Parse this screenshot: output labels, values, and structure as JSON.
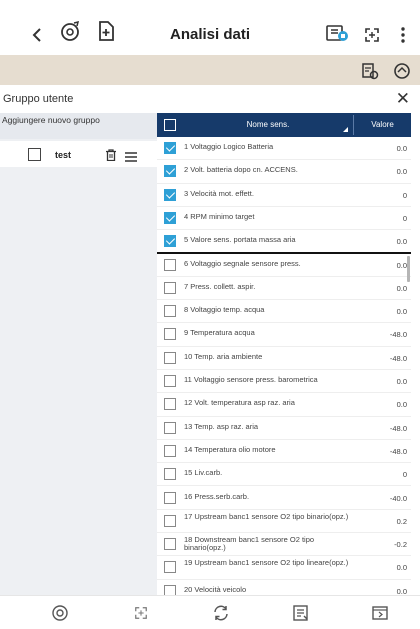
{
  "header": {
    "title": "Analisi dati",
    "icons": [
      "back-icon",
      "gauge-settings-icon",
      "add-document-icon",
      "dataset-icon",
      "fullscreen-icon",
      "more-vert-icon"
    ]
  },
  "toolbar": {
    "icons": [
      "recording-file-icon",
      "gauge-icon"
    ],
    "bg_color": "#e6ddd0"
  },
  "group_panel": {
    "title": "Gruppo utente",
    "add_label": "Aggiungere nuovo gruppo",
    "groups": [
      {
        "name": "test"
      }
    ]
  },
  "table": {
    "header_color": "#163a6a",
    "checked_color": "#2ea0d6",
    "columns": {
      "name": "Nome sens.",
      "value": "Valore"
    },
    "rows": [
      {
        "label": "1 Voltaggio Logico Batteria",
        "value": "0.0",
        "checked": true
      },
      {
        "label": "2 Volt. batteria dopo cn. ACCENS.",
        "value": "0.0",
        "checked": true
      },
      {
        "label": "3 Velocità mot. effett.",
        "value": "0",
        "checked": true
      },
      {
        "label": "4 RPM minimo target",
        "value": "0",
        "checked": true
      },
      {
        "label": "5 Valore sens. portata massa aria",
        "value": "0.0",
        "checked": true
      },
      {
        "label": "6 Voltaggio segnale sensore press.",
        "value": "0.0",
        "checked": false
      },
      {
        "label": "7 Press. collett. aspir.",
        "value": "0.0",
        "checked": false
      },
      {
        "label": "8 Voltaggio temp. acqua",
        "value": "0.0",
        "checked": false
      },
      {
        "label": "9 Temperatura acqua",
        "value": "-48.0",
        "checked": false
      },
      {
        "label": "10 Temp. aria ambiente",
        "value": "-48.0",
        "checked": false
      },
      {
        "label": "11 Voltaggio sensore press. barometrica",
        "value": "0.0",
        "checked": false
      },
      {
        "label": "12 Volt. temperatura asp raz. aria",
        "value": "0.0",
        "checked": false
      },
      {
        "label": "13 Temp. asp raz. aria",
        "value": "-48.0",
        "checked": false
      },
      {
        "label": "14 Temperatura olio motore",
        "value": "-48.0",
        "checked": false
      },
      {
        "label": "15 Liv.carb.",
        "value": "0",
        "checked": false
      },
      {
        "label": "16 Press.serb.carb.",
        "value": "-40.0",
        "checked": false
      },
      {
        "label": "17 Upstream banc1 sensore O2 tipo binario(opz.)",
        "value": "0.2",
        "checked": false
      },
      {
        "label": "18 Downstream banc1 sensore O2 tipo binario(opz.)",
        "value": "-0.2",
        "checked": false
      },
      {
        "label": "19 Upstream banc1 sensore O2 tipo lineare(opz.)",
        "value": "0.0",
        "checked": false
      },
      {
        "label": "20 Velocità veicolo",
        "value": "0.0",
        "checked": false
      }
    ]
  },
  "bottom_bar": {
    "icons": [
      "record-icon",
      "fullscreen-icon",
      "refresh-icon",
      "report-icon",
      "folder-icon"
    ]
  }
}
